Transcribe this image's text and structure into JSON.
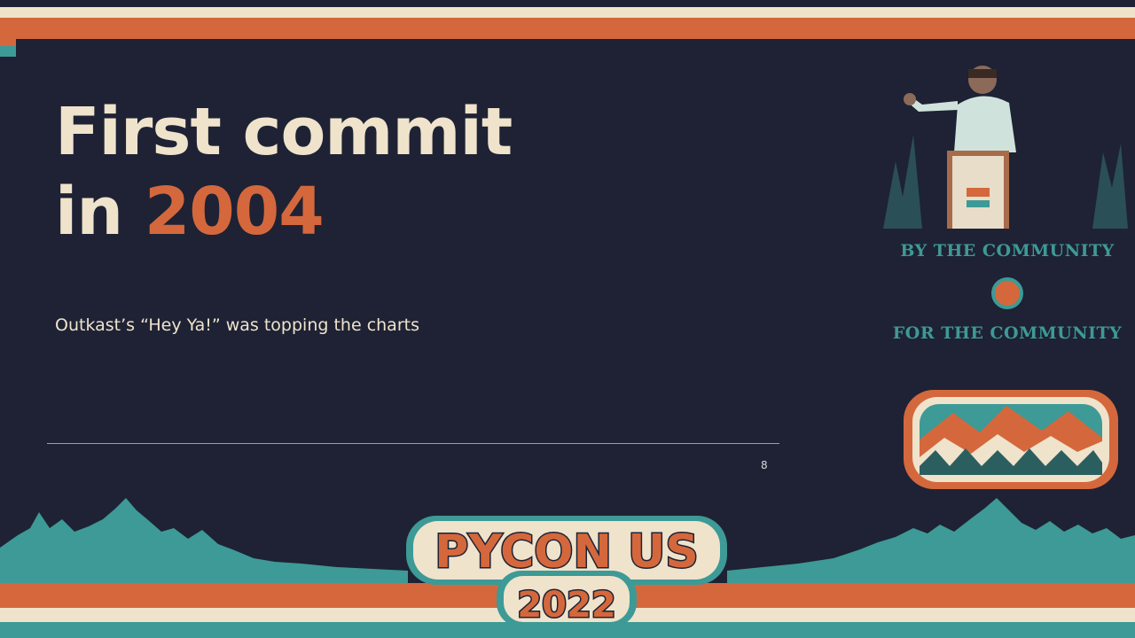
{
  "slide": {
    "title_line1": "First commit",
    "title_line2_prefix": "in ",
    "title_year": "2004",
    "subtitle": "Outkast’s “Hey Ya!” was topping the charts",
    "page_number": "8"
  },
  "sidebar": {
    "by_text": "BY THE COMMUNITY",
    "for_text": "FOR THE COMMUNITY"
  },
  "event": {
    "name": "PYCON US",
    "year": "2022"
  },
  "colors": {
    "background": "#1e2234",
    "cream": "#efe3cc",
    "orange": "#d4683c",
    "teal": "#3d9a96"
  }
}
